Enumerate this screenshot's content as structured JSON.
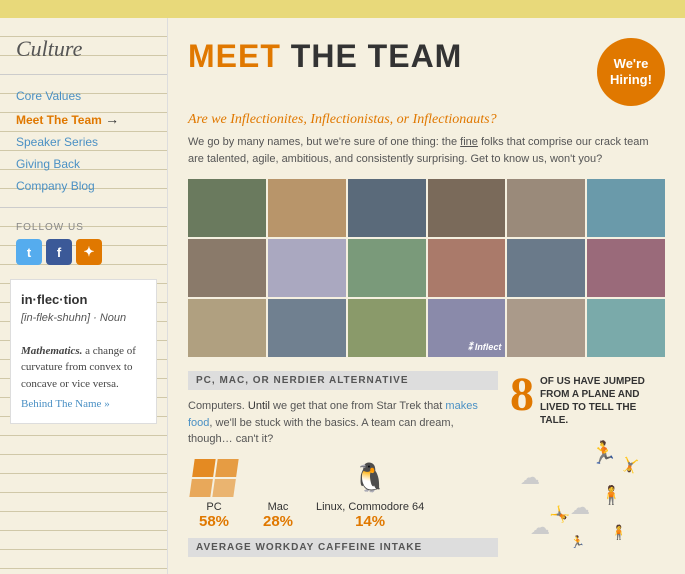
{
  "topBar": {},
  "sidebar": {
    "heading": "Culture",
    "nav": [
      {
        "label": "Core Values",
        "active": false
      },
      {
        "label": "Meet The Team",
        "active": true
      },
      {
        "label": "Speaker Series",
        "active": false
      },
      {
        "label": "Giving Back",
        "active": false
      },
      {
        "label": "Company Blog",
        "active": false
      }
    ],
    "followUs": "FOLLOW US",
    "socialIcons": [
      {
        "name": "twitter",
        "symbol": "t"
      },
      {
        "name": "facebook",
        "symbol": "f"
      },
      {
        "name": "rss",
        "symbol": "✦"
      }
    ],
    "definition": {
      "word": "in·flec·tion",
      "phonetic": "[in-flek-shuhn] · Noun",
      "math": "Mathematics.",
      "body": " a change of curvature from convex to concave or vice versa.",
      "link": "Behind The Name »"
    }
  },
  "main": {
    "titleMeet": "MEET ",
    "titleRest": "THE TEAM",
    "hiringBadge": "We're\nHiring!",
    "tagline": "Are we Inflectionites, Inflectionistas, or Inflectionauts?",
    "description": "We go by many names, but we're sure of one thing: the fine folks that comprise our crack team are talented, agile, ambitious, and consistently surprising. Get to know us, won't you?",
    "photoCells": [
      "p1",
      "p2",
      "p3",
      "p4",
      "p5",
      "p6",
      "p7",
      "p8",
      "p9",
      "p10",
      "p11",
      "p12",
      "p13",
      "p14",
      "p15",
      "p16",
      "p17",
      "p18"
    ],
    "pcSection": {
      "title": "PC, MAC, OR NERDIER ALTERNATIVE",
      "body1": "Computers. Until we get that one from Star Trek that makes food, we'll be stuck with the basics. A team can dream, though… can't it?",
      "computers": [
        {
          "label": "PC",
          "pct": "58%",
          "type": "windows"
        },
        {
          "label": "Mac",
          "pct": "28%",
          "type": "apple"
        },
        {
          "label": "Linux, Commodore 64",
          "pct": "14%",
          "type": "linux"
        }
      ]
    },
    "caffeineSection": {
      "title": "AVERAGE WORKDAY CAFFEINE INTAKE"
    },
    "statSection": {
      "number": "8",
      "text": "OF US HAVE JUMPED FROM A PLANE AND LIVED TO TELL THE TALE."
    }
  }
}
